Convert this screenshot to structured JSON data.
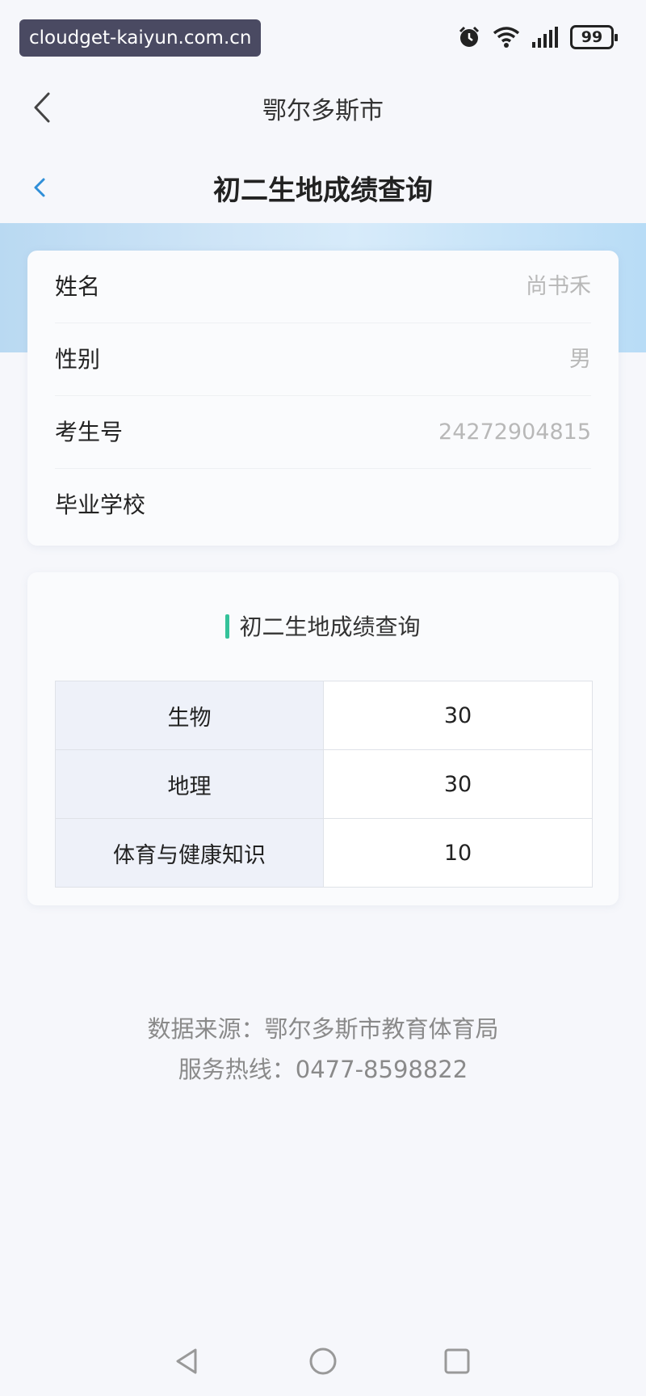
{
  "status_bar": {
    "watermark": "cloudget-kaiyun.com.cn",
    "battery": "99",
    "icons": [
      "alarm-icon",
      "wifi-icon",
      "signal-icon",
      "battery-icon"
    ]
  },
  "app_header": {
    "title": "鄂尔多斯市"
  },
  "page_header": {
    "title": "初二生地成绩查询"
  },
  "info": {
    "rows": [
      {
        "label": "姓名",
        "value": "尚书禾"
      },
      {
        "label": "性别",
        "value": "男"
      },
      {
        "label": "考生号",
        "value": "24272904815"
      },
      {
        "label": "毕业学校",
        "value": ""
      }
    ]
  },
  "scores": {
    "title": "初二生地成绩查询",
    "rows": [
      {
        "subject": "生物",
        "score": "30"
      },
      {
        "subject": "地理",
        "score": "30"
      },
      {
        "subject": "体育与健康知识",
        "score": "10"
      }
    ]
  },
  "footer": {
    "source": "数据来源：鄂尔多斯市教育体育局",
    "hotline": "服务热线：0477-8598822"
  },
  "colors": {
    "accent": "#34c29a",
    "back_blue": "#2f8fd8",
    "band_blue": "#b9d9f2"
  }
}
